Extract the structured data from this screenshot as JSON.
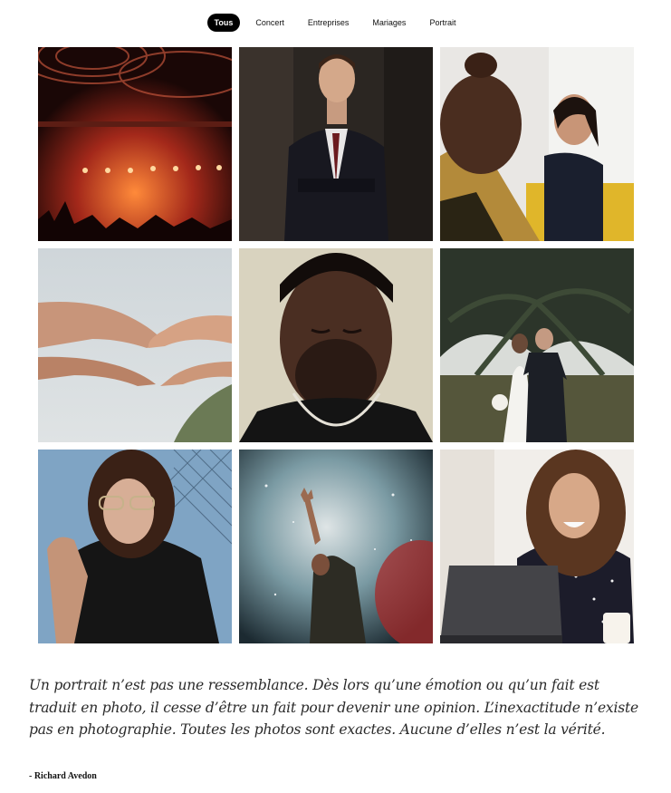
{
  "filters": [
    {
      "label": "Tous",
      "active": true
    },
    {
      "label": "Concert",
      "active": false
    },
    {
      "label": "Entreprises",
      "active": false
    },
    {
      "label": "Mariages",
      "active": false
    },
    {
      "label": "Portrait",
      "active": false
    }
  ],
  "gallery": [
    {
      "subject": "concert-stage-lights"
    },
    {
      "subject": "man-in-suit-portrait"
    },
    {
      "subject": "business-meeting-women"
    },
    {
      "subject": "reaching-hands"
    },
    {
      "subject": "man-closed-eyes-portrait"
    },
    {
      "subject": "wedding-couple-palm"
    },
    {
      "subject": "woman-glasses-portrait"
    },
    {
      "subject": "concert-raised-hand"
    },
    {
      "subject": "laughing-woman-laptop"
    }
  ],
  "quote": {
    "text": "Un portrait n’est pas une ressemblance. Dès lors qu’une émotion ou qu’un fait est traduit en photo, il cesse d’être un fait pour devenir une opinion. L’inexactitude n’existe pas en photographie. Toutes les photos sont exactes. Aucune d’elles n’est la vérité.",
    "author": "- Richard Avedon"
  }
}
